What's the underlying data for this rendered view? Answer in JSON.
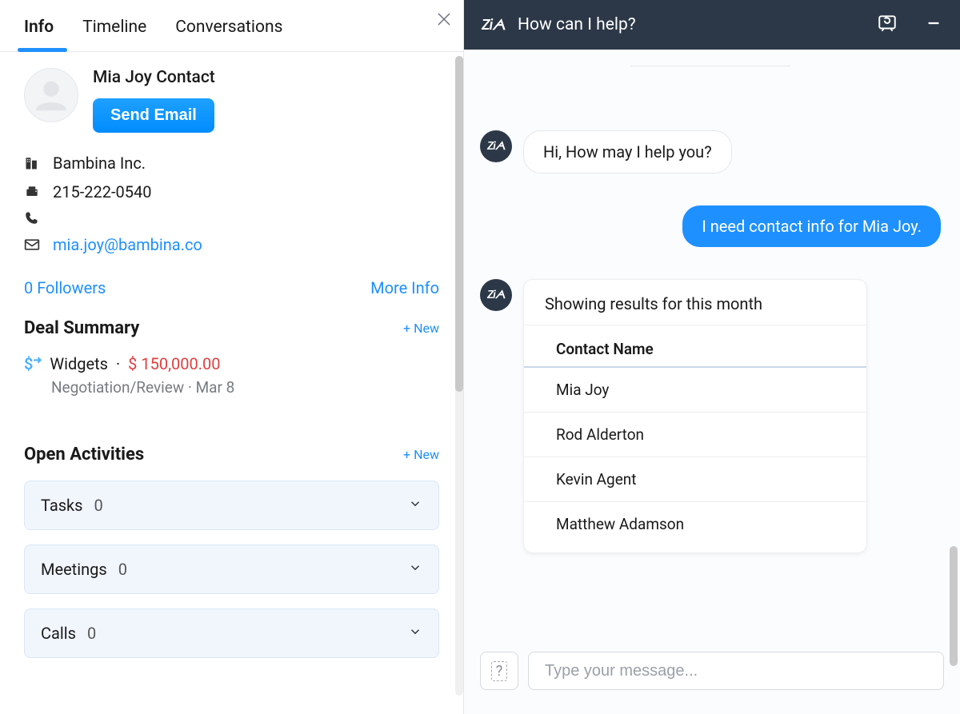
{
  "tabs": {
    "info": "Info",
    "timeline": "Timeline",
    "conversations": "Conversations"
  },
  "contact": {
    "name": "Mia Joy Contact",
    "send_email_label": "Send Email",
    "company": "Bambina Inc.",
    "phone": "215-222-0540",
    "email": "mia.joy@bambina.co",
    "followers": "0 Followers",
    "more_info": "More Info"
  },
  "deal_summary": {
    "title": "Deal Summary",
    "new_label": "+ New",
    "deal_name": "Widgets",
    "amount": "$ 150,000.00",
    "stage": "Negotiation/Review",
    "date": "Mar 8"
  },
  "open_activities": {
    "title": "Open Activities",
    "new_label": "+ New",
    "items": [
      {
        "label": "Tasks",
        "count": "0"
      },
      {
        "label": "Meetings",
        "count": "0"
      },
      {
        "label": "Calls",
        "count": "0"
      }
    ]
  },
  "chat": {
    "header_title": "How can I help?",
    "bot_greeting": "Hi, How may I help you?",
    "user_message": "I need contact info for Mia Joy.",
    "results_title": "Showing results for this month",
    "column_header": "Contact Name",
    "results": [
      "Mia Joy",
      "Rod Alderton",
      "Kevin Agent",
      "Matthew Adamson"
    ],
    "input_placeholder": "Type your message..."
  }
}
